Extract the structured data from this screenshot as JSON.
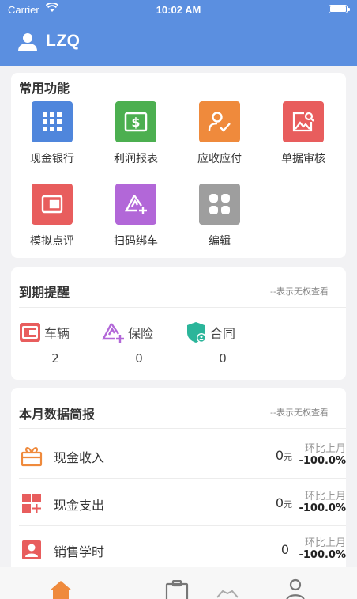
{
  "status_bar": {
    "carrier": "Carrier",
    "time": "10:02 AM",
    "wifi_icon": "wifi-icon",
    "battery_icon": "battery-icon"
  },
  "header": {
    "username": "LZQ",
    "icon": "user-icon"
  },
  "common_functions": {
    "title": "常用功能",
    "items": [
      {
        "label": "现金银行",
        "icon": "grid-apps-icon",
        "color": "#4f86dc"
      },
      {
        "label": "利润报表",
        "icon": "dollar-receipt-icon",
        "color": "#4caf50"
      },
      {
        "label": "应收应付",
        "icon": "user-check-icon",
        "color": "#ef8a3c"
      },
      {
        "label": "单据审核",
        "icon": "image-search-icon",
        "color": "#e85d5d"
      },
      {
        "label": "模拟点评",
        "icon": "wallet-icon",
        "color": "#e85d5d"
      },
      {
        "label": "扫码绑车",
        "icon": "scan-add-icon",
        "color": "#b267d8"
      },
      {
        "label": "编辑",
        "icon": "tiles-icon",
        "color": "#9e9e9e"
      }
    ]
  },
  "due_reminder": {
    "title": "到期提醒",
    "hint": "--表示无权查看",
    "items": [
      {
        "label": "车辆",
        "count": "2",
        "icon": "wallet-icon",
        "color": "#e85d5d"
      },
      {
        "label": "保险",
        "count": "0",
        "icon": "scan-add-icon",
        "color": "#b267d8"
      },
      {
        "label": "合同",
        "count": "0",
        "icon": "shield-user-icon",
        "color": "#2bb59a"
      }
    ]
  },
  "monthly_report": {
    "title": "本月数据简报",
    "hint": "--表示无权查看",
    "rows": [
      {
        "label": "现金收入",
        "value": "0",
        "unit": "元",
        "cmp_label": "环比上月",
        "cmp_value": "-100.0%",
        "icon": "gift-icon",
        "color": "#ef8a3c"
      },
      {
        "label": "现金支出",
        "value": "0",
        "unit": "元",
        "cmp_label": "环比上月",
        "cmp_value": "-100.0%",
        "icon": "tiles-add-icon",
        "color": "#e85d5d"
      },
      {
        "label": "销售学时",
        "value": "0",
        "unit": "",
        "cmp_label": "环比上月",
        "cmp_value": "-100.0%",
        "icon": "person-card-icon",
        "color": "#e85d5d"
      }
    ]
  },
  "tab_bar": {
    "tabs": [
      {
        "icon": "home-icon",
        "color": "#ef8a3c"
      },
      {
        "icon": "clipboard-icon",
        "color": "#777777"
      },
      {
        "icon": "handshake-icon",
        "color": "#999999"
      },
      {
        "icon": "person-icon",
        "color": "#777777"
      }
    ]
  }
}
